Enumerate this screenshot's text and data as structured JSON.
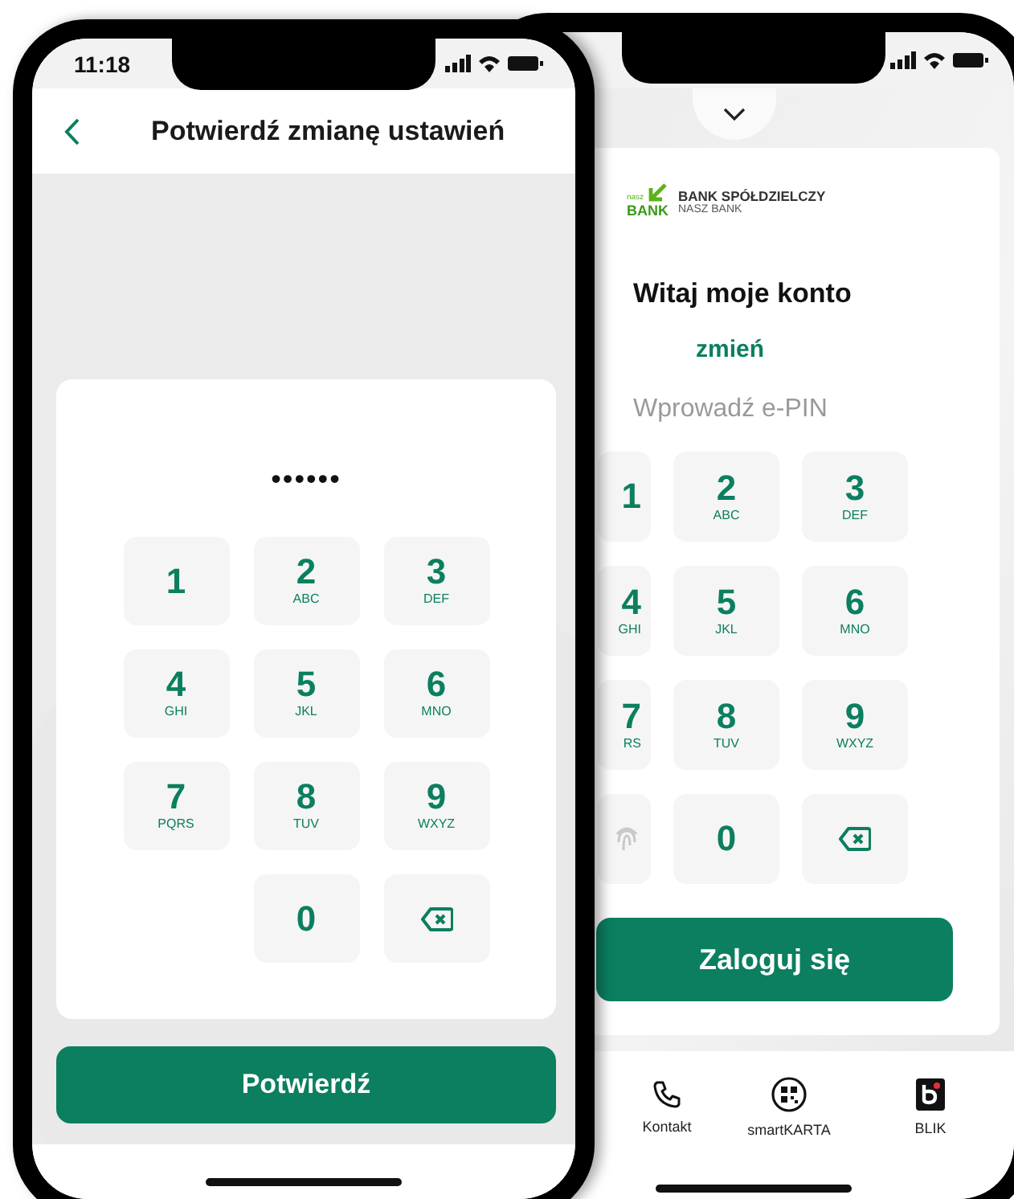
{
  "phones": [
    {
      "kind": "confirm",
      "status_bar": {
        "time": "11:18"
      },
      "header": {
        "title": "Potwierdź zmianę ustawień"
      },
      "pin_field": {
        "value": "••••••"
      },
      "keypad": [
        {
          "kind": "digit",
          "digit": "1"
        },
        {
          "kind": "digit",
          "digit": "2",
          "letters": "ABC"
        },
        {
          "kind": "digit",
          "digit": "3",
          "letters": "DEF"
        },
        {
          "kind": "digit",
          "digit": "4",
          "letters": "GHI"
        },
        {
          "kind": "digit",
          "digit": "5",
          "letters": "JKL"
        },
        {
          "kind": "digit",
          "digit": "6",
          "letters": "MNO"
        },
        {
          "kind": "digit",
          "digit": "7",
          "letters": "PQRS"
        },
        {
          "kind": "digit",
          "digit": "8",
          "letters": "TUV"
        },
        {
          "kind": "digit",
          "digit": "9",
          "letters": "WXYZ"
        },
        {
          "kind": "blank"
        },
        {
          "kind": "digit",
          "digit": "0"
        },
        {
          "kind": "backspace"
        }
      ],
      "button": "Potwierdź"
    },
    {
      "kind": "login",
      "logo": {
        "small": "nasz",
        "mark": "BANK",
        "name": "BANK SPÓŁDZIELCZY",
        "subname": "NASZ BANK"
      },
      "greeting": "Witaj moje konto",
      "change_link": "zmień",
      "prompt": "Wprowadź e-PIN",
      "keypad": [
        {
          "kind": "digit",
          "digit": "1"
        },
        {
          "kind": "digit",
          "digit": "2",
          "letters": "ABC"
        },
        {
          "kind": "digit",
          "digit": "3",
          "letters": "DEF"
        },
        {
          "kind": "digit",
          "digit": "4",
          "letters": "GHI"
        },
        {
          "kind": "digit",
          "digit": "5",
          "letters": "JKL"
        },
        {
          "kind": "digit",
          "digit": "6",
          "letters": "MNO"
        },
        {
          "kind": "digit",
          "digit": "7",
          "letters": "RS"
        },
        {
          "kind": "digit",
          "digit": "8",
          "letters": "TUV"
        },
        {
          "kind": "digit",
          "digit": "9",
          "letters": "WXYZ"
        },
        {
          "kind": "fingerprint"
        },
        {
          "kind": "digit",
          "digit": "0"
        },
        {
          "kind": "backspace"
        }
      ],
      "button": "Zaloguj się",
      "nav": [
        {
          "kind": "phone",
          "label": "Kontakt"
        },
        {
          "kind": "card",
          "label": "smartKARTA"
        },
        {
          "kind": "blik",
          "label": "BLIK"
        }
      ]
    }
  ]
}
